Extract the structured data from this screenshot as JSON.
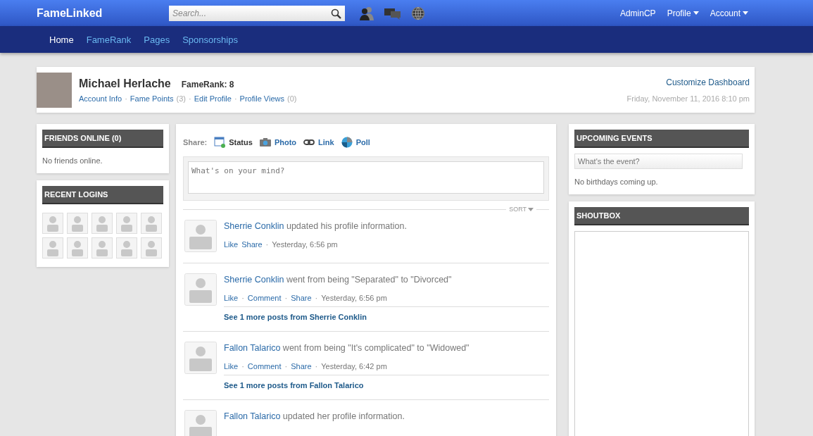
{
  "topbar": {
    "logo": "FameLinked",
    "search": {
      "placeholder": "Search..."
    },
    "right_links": [
      {
        "label": "AdminCP",
        "dropdown": false
      },
      {
        "label": "Profile",
        "dropdown": true
      },
      {
        "label": "Account",
        "dropdown": true
      }
    ]
  },
  "nav": [
    {
      "label": "Home",
      "selected": true
    },
    {
      "label": "FameRank",
      "selected": false
    },
    {
      "label": "Pages",
      "selected": false
    },
    {
      "label": "Sponsorships",
      "selected": false
    }
  ],
  "profile": {
    "name": "Michael Herlache",
    "famerank": "FameRank: 8",
    "separator": "·",
    "links": [
      {
        "label": "Account Info"
      },
      {
        "label": "Fame Points",
        "count": "(3)"
      },
      {
        "label": "Edit Profile"
      },
      {
        "label": "Profile Views",
        "count": "(0)"
      }
    ],
    "customize": "Customize Dashboard",
    "date": "Friday, November 11, 2016 8:10 pm"
  },
  "friends_online": {
    "title": "FRIENDS ONLINE (0)",
    "empty": "No friends online."
  },
  "recent_logins": {
    "title": "RECENT LOGINS",
    "users": [
      {
        "kind": "avatar"
      },
      {
        "kind": "avatar"
      },
      {
        "kind": "avatar"
      },
      {
        "kind": "avatar"
      },
      {
        "kind": "avatar"
      },
      {
        "kind": "avatar"
      },
      {
        "kind": "avatar"
      },
      {
        "kind": "avatar"
      },
      {
        "kind": "avatar"
      },
      {
        "kind": "avatar"
      }
    ]
  },
  "share": {
    "label": "Share:",
    "tabs": [
      {
        "label": "Status",
        "kind": "status",
        "selected": true
      },
      {
        "label": "Photo",
        "kind": "photo",
        "selected": false
      },
      {
        "label": "Link",
        "kind": "link",
        "selected": false
      },
      {
        "label": "Poll",
        "kind": "poll",
        "selected": false
      }
    ],
    "placeholder": "What's on your mind?"
  },
  "sort": "SORT",
  "feed": [
    {
      "actor": "Sherrie Conklin",
      "text": "updated his profile information.",
      "meta": [
        {
          "kind": "link",
          "label": "Like"
        },
        {
          "kind": "link",
          "label": "Share"
        },
        {
          "kind": "sep",
          "label": "·"
        },
        {
          "kind": "time",
          "label": "Yesterday, 6:56 pm"
        }
      ]
    },
    {
      "actor": "Sherrie Conklin",
      "text": "went from being \"Separated\" to \"Divorced\"",
      "meta": [
        {
          "kind": "link",
          "label": "Like"
        },
        {
          "kind": "sep",
          "label": "·"
        },
        {
          "kind": "link",
          "label": "Comment"
        },
        {
          "kind": "sep",
          "label": "·"
        },
        {
          "kind": "link",
          "label": "Share"
        },
        {
          "kind": "sep",
          "label": "·"
        },
        {
          "kind": "time",
          "label": "Yesterday, 6:56 pm"
        }
      ],
      "more": "See 1 more posts from Sherrie Conklin"
    },
    {
      "actor": "Fallon Talarico",
      "text": "went from being \"It's complicated\" to \"Widowed\"",
      "meta": [
        {
          "kind": "link",
          "label": "Like"
        },
        {
          "kind": "sep",
          "label": "·"
        },
        {
          "kind": "link",
          "label": "Comment"
        },
        {
          "kind": "sep",
          "label": "·"
        },
        {
          "kind": "link",
          "label": "Share"
        },
        {
          "kind": "sep",
          "label": "·"
        },
        {
          "kind": "time",
          "label": "Yesterday, 6:42 pm"
        }
      ],
      "more": "See 1 more posts from Fallon Talarico"
    },
    {
      "actor": "Fallon Talarico",
      "text": "updated her profile information."
    }
  ],
  "upcoming_events": {
    "title": "UPCOMING EVENTS",
    "placeholder": "What's the event?",
    "empty": "No birthdays coming up."
  },
  "shoutbox": {
    "title": "SHOUTBOX"
  }
}
